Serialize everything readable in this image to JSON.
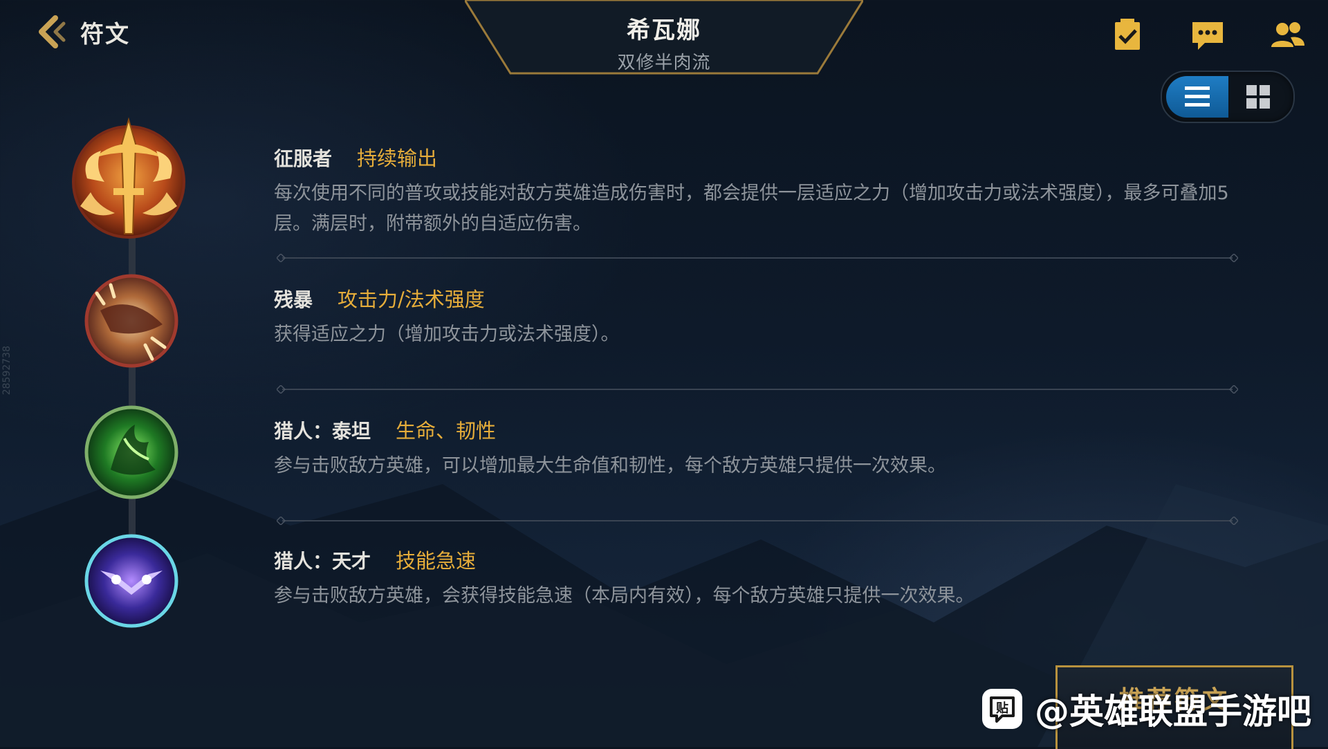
{
  "header": {
    "back_label": "符文",
    "champion_name": "希瓦娜",
    "build_name": "双修半肉流"
  },
  "top_icons": [
    "task-icon",
    "chat-icon",
    "friends-icon"
  ],
  "view_toggle": {
    "options": [
      "list-view-icon",
      "grid-view-icon"
    ],
    "selected": "list"
  },
  "runes": [
    {
      "name": "征服者",
      "tag": "持续输出",
      "description": "每次使用不同的普攻或技能对敌方英雄造成伤害时，都会提供一层适应之力（增加攻击力或法术强度），最多可叠加5层。满层时，附带额外的自适应伤害。",
      "icon": "conqueror-rune-icon"
    },
    {
      "name": "残暴",
      "tag": "攻击力/法术强度",
      "description": "获得适应之力（增加攻击力或法术强度）。",
      "icon": "brutal-rune-icon"
    },
    {
      "name": "猎人：泰坦",
      "tag": "生命、韧性",
      "description": "参与击败敌方英雄，可以增加最大生命值和韧性，每个敌方英雄只提供一次效果。",
      "icon": "hunter-titan-rune-icon"
    },
    {
      "name": "猎人：天才",
      "tag": "技能急速",
      "description": "参与击败敌方英雄，会获得技能急速（本局内有效），每个敌方英雄只提供一次效果。",
      "icon": "hunter-genius-rune-icon"
    }
  ],
  "recommend_button": "推荐符文",
  "watermark": {
    "logo_char": "贴",
    "text": "@英雄联盟手游吧"
  },
  "side_id": "28592738",
  "colors": {
    "accent_gold": "#e6ad3a",
    "toggle_blue": "#1f7dc4",
    "banner_border": "#b8923e"
  }
}
